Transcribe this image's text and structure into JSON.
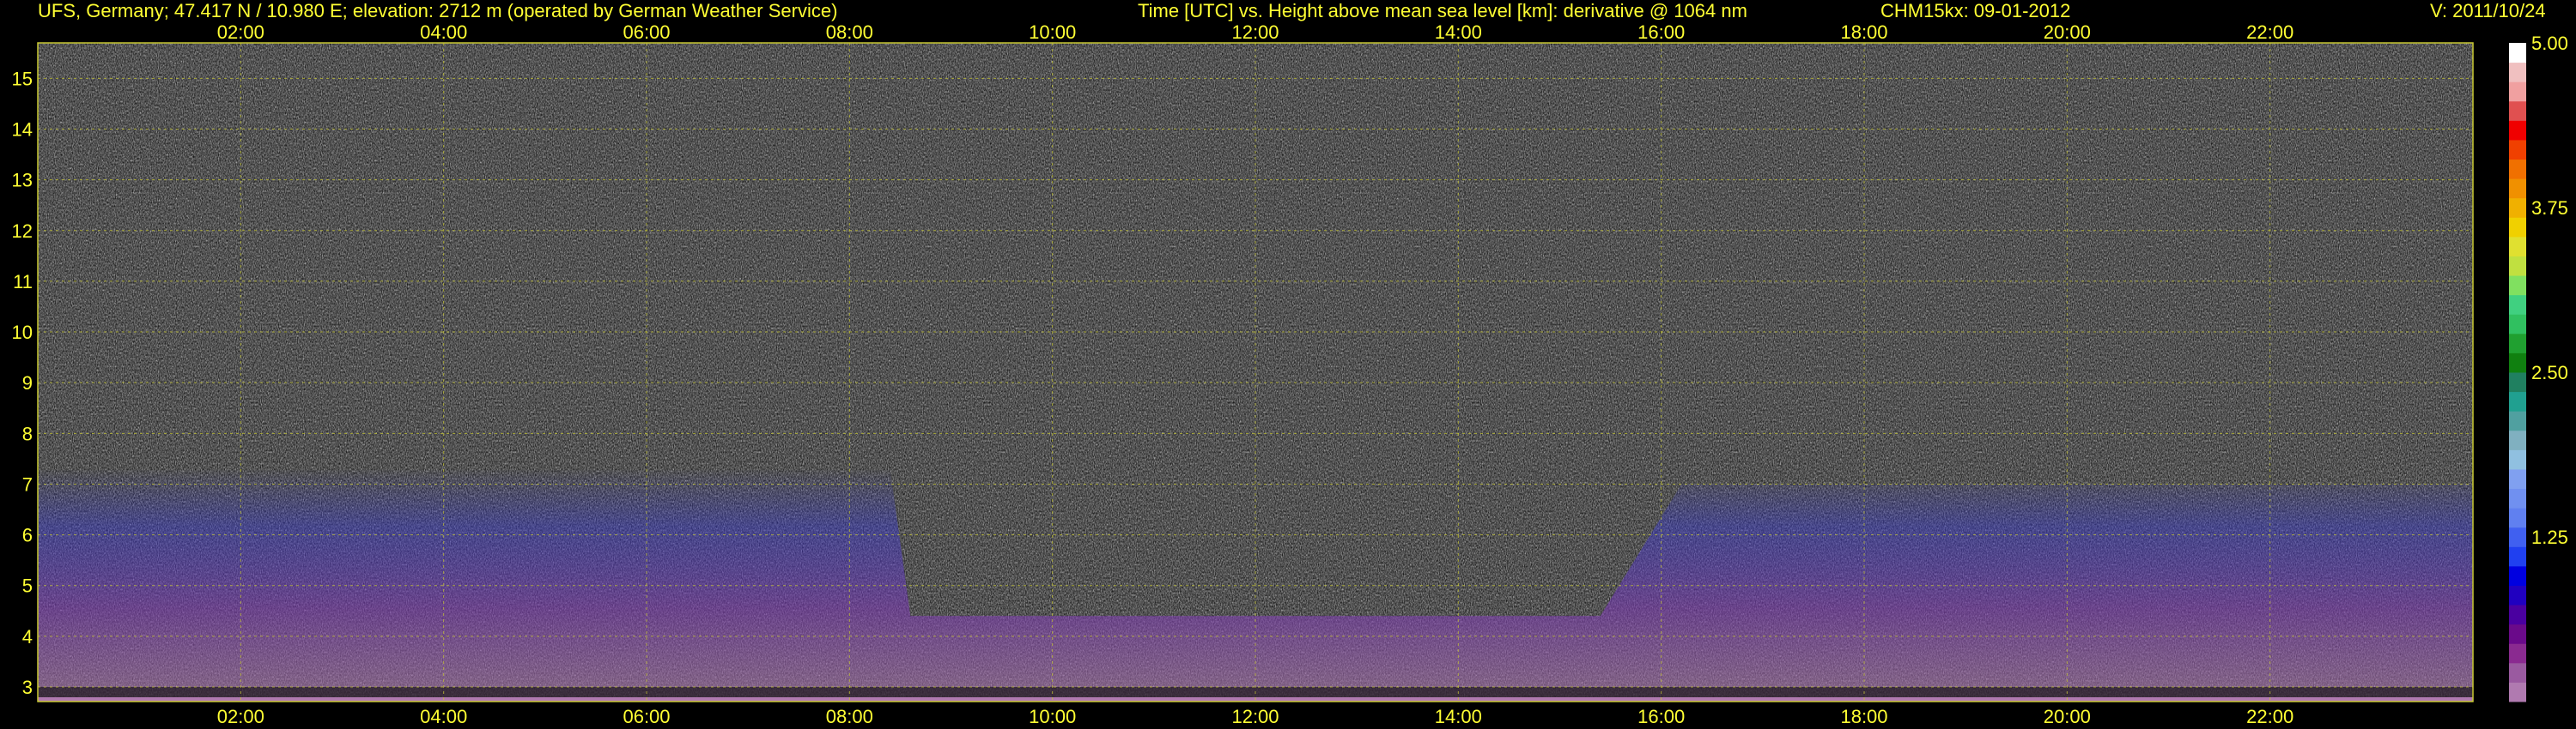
{
  "header": {
    "station": "UFS, Germany; 47.417 N / 10.980 E; elevation: 2712 m  (operated by German Weather Service)",
    "description": "Time [UTC] vs. Height above mean sea level [km]: derivative @ 1064 nm",
    "instrument": "CHM15kx: 09-01-2012",
    "version": "V: 2011/10/24"
  },
  "colors": {
    "background": "#000000",
    "text": "#ffff33",
    "grid": "#c8c832",
    "noise_light": "#e8e8e8",
    "noise_dark": "#2a2a2a",
    "layer_blue": "#3a3ad0",
    "layer_purple": "#8a3aa0",
    "ground": "#b07ab0"
  },
  "chart_data": {
    "type": "heatmap",
    "title": "Time [UTC] vs. Height above mean sea level [km]: derivative @ 1064 nm",
    "x_ticks": [
      "02:00",
      "04:00",
      "06:00",
      "08:00",
      "10:00",
      "12:00",
      "14:00",
      "16:00",
      "18:00",
      "20:00",
      "22:00"
    ],
    "x_tick_hours": [
      2,
      4,
      6,
      8,
      10,
      12,
      14,
      16,
      18,
      20,
      22
    ],
    "xlim": [
      0,
      24
    ],
    "y_ticks": [
      "3",
      "4",
      "5",
      "6",
      "7",
      "8",
      "9",
      "10",
      "11",
      "12",
      "13",
      "14",
      "15"
    ],
    "y_tick_values": [
      3,
      4,
      5,
      6,
      7,
      8,
      9,
      10,
      11,
      12,
      13,
      14,
      15
    ],
    "ylim": [
      2.712,
      15.7
    ],
    "grid": true,
    "colorbar": {
      "tick_labels": [
        "5.00",
        "3.75",
        "2.50",
        "1.25"
      ],
      "tick_values": [
        5.0,
        3.75,
        2.5,
        1.25
      ],
      "range": [
        0,
        5
      ],
      "colors": [
        "#b07ab0",
        "#9a5aa0",
        "#8a2a90",
        "#6a0a8a",
        "#4a00a0",
        "#2000c0",
        "#0000e0",
        "#2040f0",
        "#4060f0",
        "#6080f0",
        "#7090f0",
        "#80a0f0",
        "#90c0e0",
        "#80b0c0",
        "#50a0a0",
        "#20a090",
        "#208060",
        "#108010",
        "#20a030",
        "#30c060",
        "#40d080",
        "#80e060",
        "#c0e040",
        "#e0e030",
        "#f0d000",
        "#f0b000",
        "#f09000",
        "#f07000",
        "#f04000",
        "#f00000",
        "#e05050",
        "#f0a0a0",
        "#f0c0c0",
        "#ffffff"
      ]
    },
    "aerosol_layer_top_km": [
      {
        "hour": 0,
        "km": 7.3
      },
      {
        "hour": 8.4,
        "km": 7.3
      },
      {
        "hour": 8.6,
        "km": 4.4
      },
      {
        "hour": 15.4,
        "km": 4.4
      },
      {
        "hour": 16.2,
        "km": 7.0
      },
      {
        "hour": 24,
        "km": 7.0
      }
    ]
  }
}
